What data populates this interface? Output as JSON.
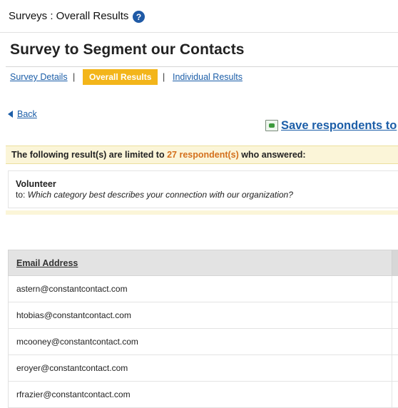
{
  "header": {
    "breadcrumb_title": "Surveys : Overall Results",
    "help_icon": "question-circle-icon",
    "help_glyph": "?"
  },
  "survey": {
    "title": "Survey to Segment our Contacts"
  },
  "tabs": [
    {
      "label": "Survey Details",
      "active": false
    },
    {
      "label": "Overall Results",
      "active": true
    },
    {
      "label": "Individual Results",
      "active": false
    }
  ],
  "separator": "|",
  "back": {
    "label": "Back"
  },
  "save": {
    "label": "Save respondents to",
    "icon": "save-contacts-icon"
  },
  "notice": {
    "prefix": "The following result(s) are limited to ",
    "count": "27 respondent(s)",
    "suffix": " who answered:"
  },
  "question": {
    "answer": "Volunteer",
    "to_label": "to: ",
    "text": "Which category best describes your connection with our organization?"
  },
  "table": {
    "column_header": "Email Address",
    "rows": [
      "astern@constantcontact.com",
      "htobias@constantcontact.com",
      "mcooney@constantcontact.com",
      "eroyer@constantcontact.com",
      "rfrazier@constantcontact.com"
    ]
  },
  "colors": {
    "accent": "#f3b51a",
    "link": "#1c5ea8",
    "highlight_count": "#d4701c",
    "notice_bg": "#fbf5d8"
  }
}
